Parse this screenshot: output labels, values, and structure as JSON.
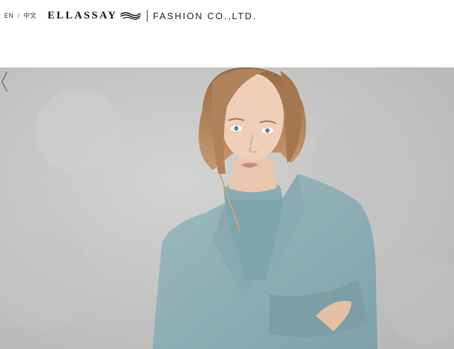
{
  "language_switch": {
    "en": "EN",
    "separator": "/",
    "zh": "中文"
  },
  "brand": {
    "name": "ELLASSAY",
    "subtitle": "FASHION CO.,LTD."
  },
  "hero": {
    "slide_icon": "prev-arrow-icon"
  },
  "colors": {
    "coat": "#8fb0b6",
    "background": "#c9c9c7",
    "text": "#1a1a1a"
  }
}
